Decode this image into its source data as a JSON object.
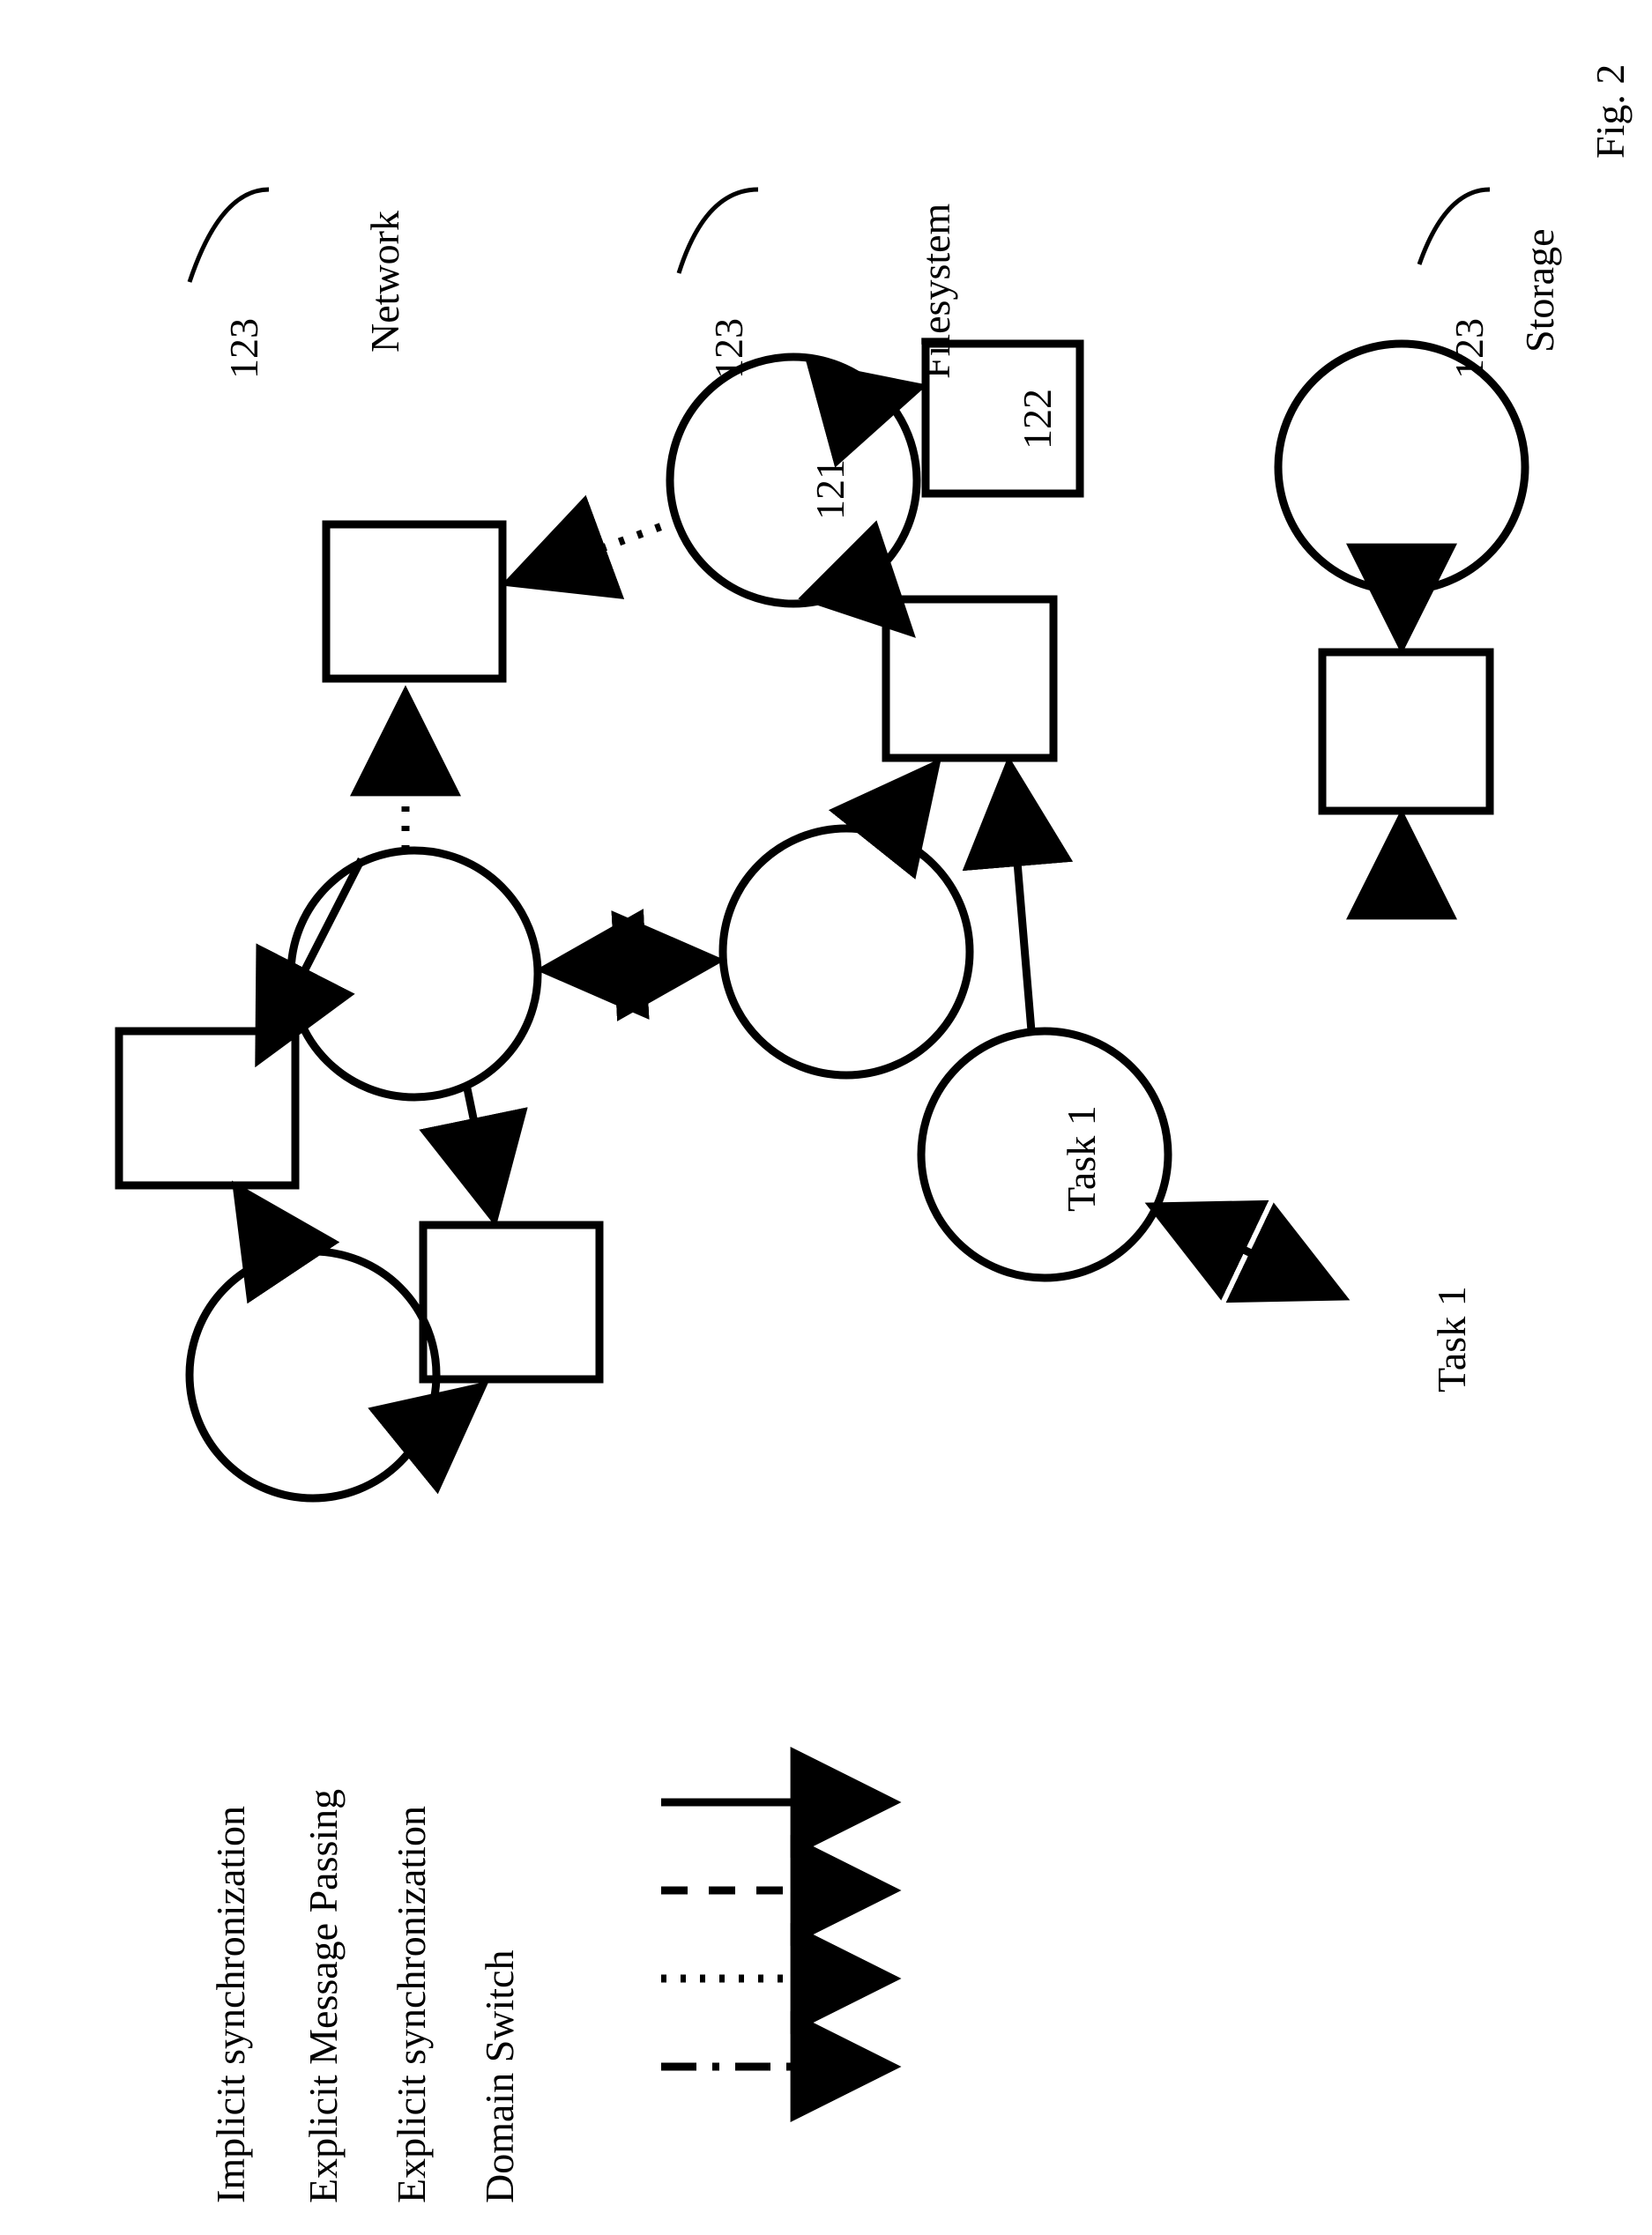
{
  "figure_label": "Fig. 2",
  "domains": {
    "network": {
      "label": "Network",
      "ref": "123"
    },
    "filesystem": {
      "label": "Filesystem",
      "ref": "123"
    },
    "storage": {
      "label": "Storage",
      "ref": "123"
    }
  },
  "nodes": {
    "fs_task_121": "121",
    "fs_obj_122": "122",
    "fs_task1_a": "Task 1",
    "storage_task1_b": "Task 1"
  },
  "legend": {
    "implicit_sync": "Implicit synchronization",
    "explicit_msg": "Explicit Message Passing",
    "explicit_sync": "Explicit synchronization",
    "domain_switch": "Domain Switch"
  }
}
